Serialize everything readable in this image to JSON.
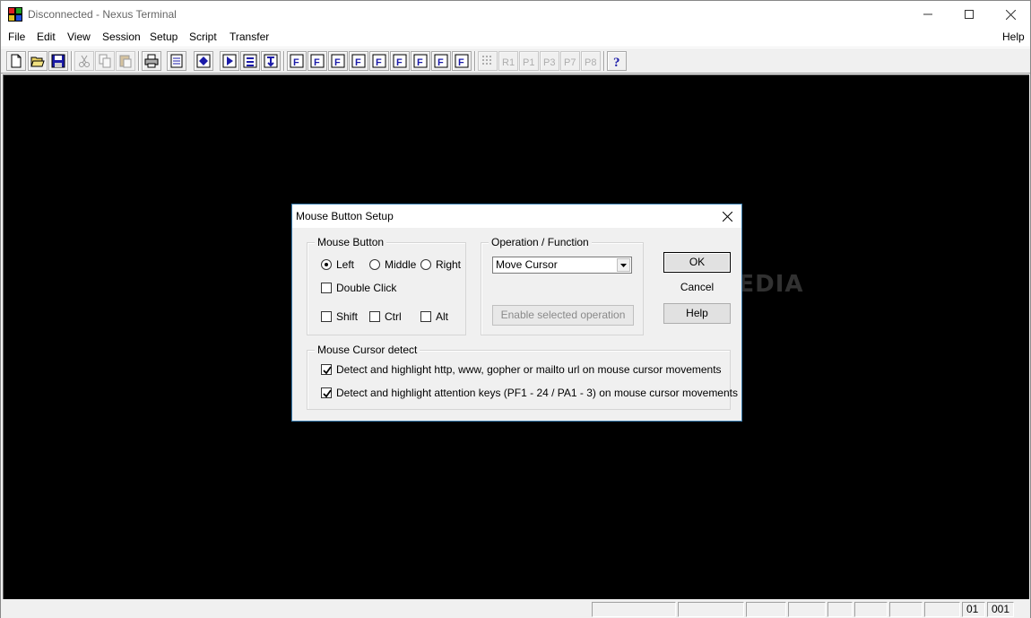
{
  "window": {
    "title": "Disconnected - Nexus Terminal"
  },
  "menu": {
    "file": "File",
    "edit": "Edit",
    "view": "View",
    "session": "Session",
    "setup": "Setup",
    "script": "Script",
    "transfer": "Transfer",
    "help": "Help"
  },
  "toolbar": {
    "macro_labels": [
      "F",
      "F",
      "F",
      "F",
      "F",
      "F",
      "F",
      "F",
      "F"
    ],
    "disabled_labels": [
      "R1",
      "P1",
      "P3",
      "P7",
      "P8"
    ]
  },
  "dialog": {
    "title": "Mouse Button Setup",
    "mouse_button": {
      "label": "Mouse Button",
      "left": "Left",
      "middle": "Middle",
      "right": "Right",
      "double_click": "Double Click",
      "shift": "Shift",
      "ctrl": "Ctrl",
      "alt": "Alt"
    },
    "operation": {
      "label": "Operation / Function",
      "selected": "Move Cursor",
      "enable_button": "Enable selected operation"
    },
    "buttons": {
      "ok": "OK",
      "cancel": "Cancel",
      "help": "Help"
    },
    "cursor_detect": {
      "label": "Mouse Cursor detect",
      "url_option": "Detect and highlight http, www, gopher or mailto url on mouse cursor movements",
      "attention_option": "Detect and highlight attention keys (PF1 - 24 / PA1 - 3) on mouse cursor movements"
    }
  },
  "statusbar": {
    "row": "01",
    "col": "001"
  },
  "watermark": "SOFTPEDIA",
  "colors": {
    "terminal_bg": "#000000",
    "dialog_border": "#3c7fb1",
    "icon_blue": "#1a1aa8"
  }
}
